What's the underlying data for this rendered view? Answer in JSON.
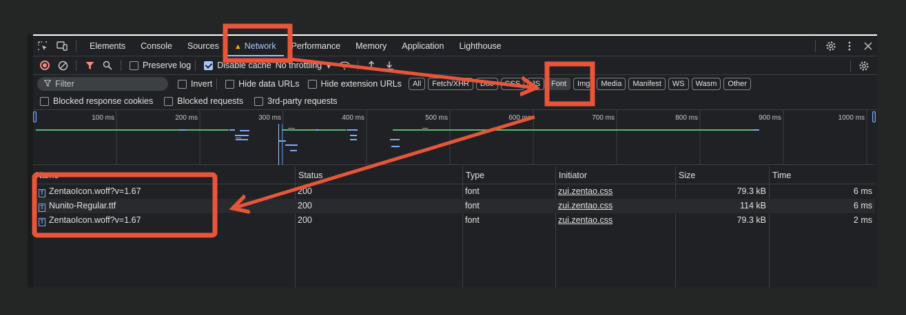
{
  "tabs": [
    {
      "label": "Elements"
    },
    {
      "label": "Console"
    },
    {
      "label": "Sources"
    },
    {
      "label": "Network"
    },
    {
      "label": "Performance"
    },
    {
      "label": "Memory"
    },
    {
      "label": "Application"
    },
    {
      "label": "Lighthouse"
    }
  ],
  "toolbar": {
    "preserve_log": "Preserve log",
    "disable_cache": "Disable cache",
    "throttling": "No throttling"
  },
  "filter": {
    "placeholder": "Filter",
    "invert": "Invert",
    "hide_data_urls": "Hide data URLs",
    "hide_extension_urls": "Hide extension URLs",
    "types": [
      "All",
      "Fetch/XHR",
      "Doc",
      "CSS",
      "JS",
      "Font",
      "Img",
      "Media",
      "Manifest",
      "WS",
      "Wasm",
      "Other"
    ],
    "selected_type": "Font"
  },
  "row4": {
    "blocked_cookies": "Blocked response cookies",
    "blocked_requests": "Blocked requests",
    "third_party": "3rd-party requests"
  },
  "overview": {
    "ticks": [
      "100 ms",
      "200 ms",
      "300 ms",
      "400 ms",
      "500 ms",
      "600 ms",
      "700 ms",
      "800 ms",
      "900 ms",
      "1000 ms"
    ]
  },
  "table": {
    "headers": {
      "name": "Name",
      "status": "Status",
      "type": "Type",
      "initiator": "Initiator",
      "size": "Size",
      "time": "Time"
    },
    "rows": [
      {
        "name": "ZentaoIcon.woff?v=1.67",
        "status": "200",
        "type": "font",
        "initiator": "zui.zentao.css",
        "size": "79.3 kB",
        "time": "6 ms"
      },
      {
        "name": "Nunito-Regular.ttf",
        "status": "200",
        "type": "font",
        "initiator": "zui.zentao.css",
        "size": "114 kB",
        "time": "6 ms"
      },
      {
        "name": "ZentaoIcon.woff?v=1.67",
        "status": "200",
        "type": "font",
        "initiator": "zui.zentao.css",
        "size": "79.3 kB",
        "time": "2 ms"
      }
    ]
  },
  "colors": {
    "annotation": "#e8553a",
    "accent": "#a8c7fa",
    "warning": "#f9ab00",
    "record": "#f28b82"
  }
}
